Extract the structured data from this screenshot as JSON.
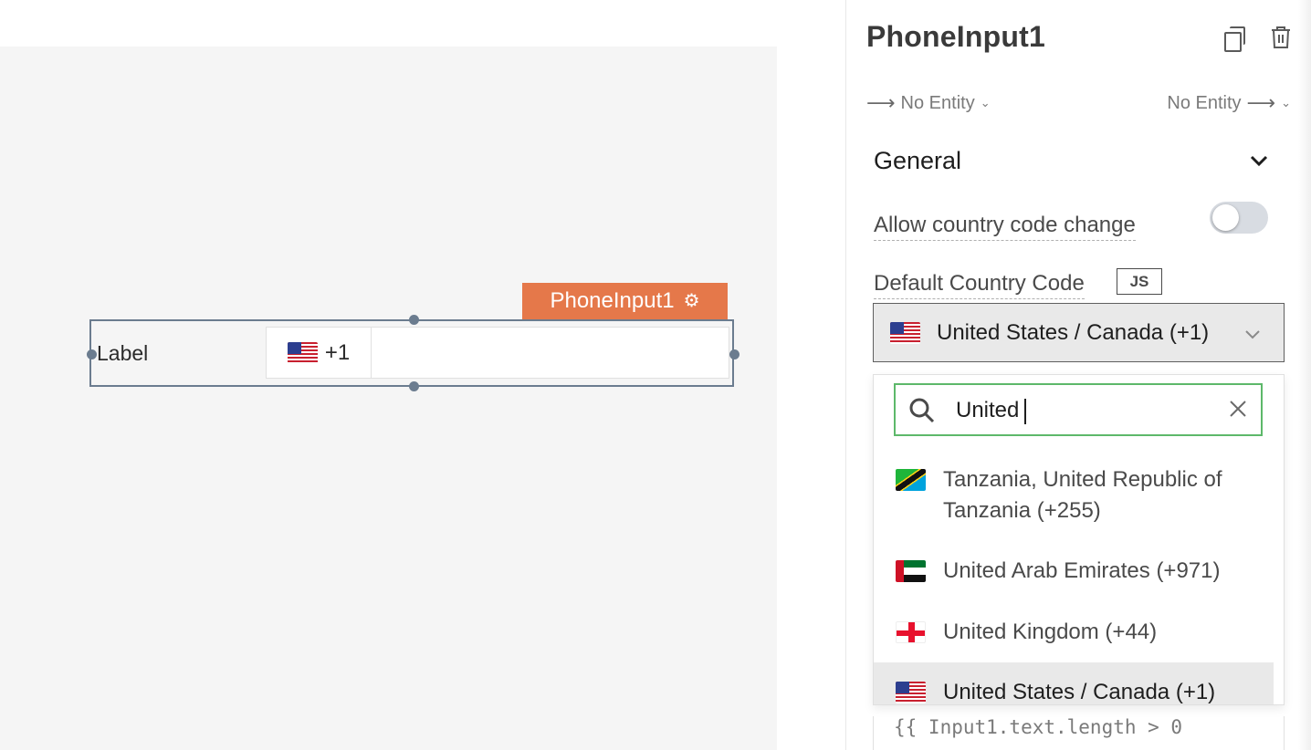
{
  "canvas": {
    "widget_tag": "PhoneInput1",
    "widget": {
      "label": "Label",
      "country_code": "+1",
      "flag": "flag-us-icon",
      "number_value": ""
    }
  },
  "pane": {
    "title": "PhoneInput1",
    "icons": [
      "copy-icon",
      "trash-icon"
    ],
    "entity_in": "No Entity",
    "entity_out": "No Entity",
    "section": "General",
    "allow_country_code_change": {
      "label": "Allow country code change",
      "enabled": false
    },
    "default_country_code": {
      "label": "Default Country Code",
      "js_badge": "JS",
      "selected": "United States / Canada (+1)",
      "selected_flag": "flag-us-icon"
    },
    "dropdown": {
      "search_value": "United",
      "options": [
        {
          "flag": "flag-tz-icon",
          "line1": "Tanzania, United Republic of",
          "line2": "Tanzania (+255)",
          "selected": false
        },
        {
          "flag": "flag-ae-icon",
          "line1": "United Arab Emirates (+971)",
          "selected": false
        },
        {
          "flag": "flag-gg-icon",
          "line1": "United Kingdom (+44)",
          "selected": false
        },
        {
          "flag": "flag-us-icon",
          "line1": "United States / Canada (+1)",
          "selected": true
        }
      ]
    },
    "code_peek": "{{ Input1.text.length > 0"
  },
  "colors": {
    "accent_orange": "#e5784a",
    "search_focus_green": "#5db86a",
    "selection_frame": "#6b7c8f",
    "selected_bg": "#e9e9e9"
  }
}
